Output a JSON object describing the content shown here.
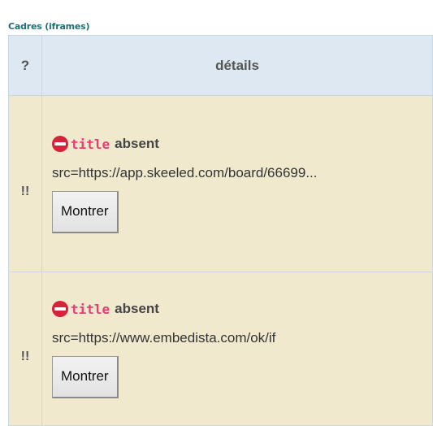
{
  "caption": "Cadres (iframes)",
  "table": {
    "headers": {
      "question": "?",
      "details": "détails"
    },
    "rows": [
      {
        "severity": "!!",
        "title_attr": "title",
        "status": "absent",
        "src": "src=https://app.skeeled.com/board/66699...",
        "button_label": "Montrer"
      },
      {
        "severity": "!!",
        "title_attr": "title",
        "status": "absent",
        "src": "src=https://www.embedista.com/ok/if",
        "button_label": "Montrer"
      }
    ]
  },
  "icons": {
    "status": "stop-icon"
  },
  "colors": {
    "error": "#d6223a",
    "code": "#e83c74",
    "row_bg": "#f1e9cd",
    "header_bg": "#dde8f3"
  }
}
